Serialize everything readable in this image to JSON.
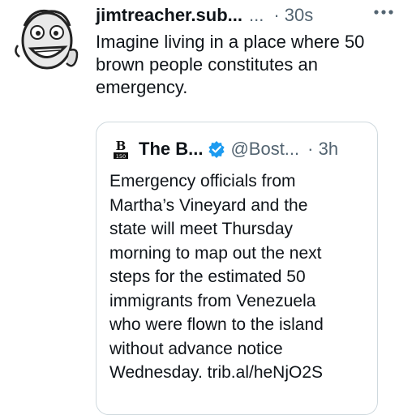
{
  "tweet": {
    "username": "jimtreacher.sub...",
    "more_dots": "...",
    "time": "· 30s",
    "text_lines": [
      "Imagine living in a place where 50",
      "brown people constitutes an",
      "emergency."
    ],
    "avatar_icon": "cartoon-face-avatar"
  },
  "quote": {
    "avatar_icon": "newspaper-logo-avatar",
    "name": "The B...",
    "verified_icon": "verified-badge-icon",
    "handle": "@Bost...",
    "time": "· 3h",
    "text_lines": [
      "Emergency officials from",
      "Martha’s Vineyard and the",
      "state will meet Thursday",
      "morning to map out the next",
      "steps for the estimated 50",
      "immigrants from Venezuela",
      "who were flown to the island",
      "without advance notice",
      "Wednesday. trib.al/heNjO2S"
    ],
    "logo_text": "B",
    "logo_sub": "150"
  },
  "colors": {
    "text": "#0f1419",
    "muted": "#536471",
    "verified": "#1d9bf0",
    "border": "#cfd9de"
  }
}
